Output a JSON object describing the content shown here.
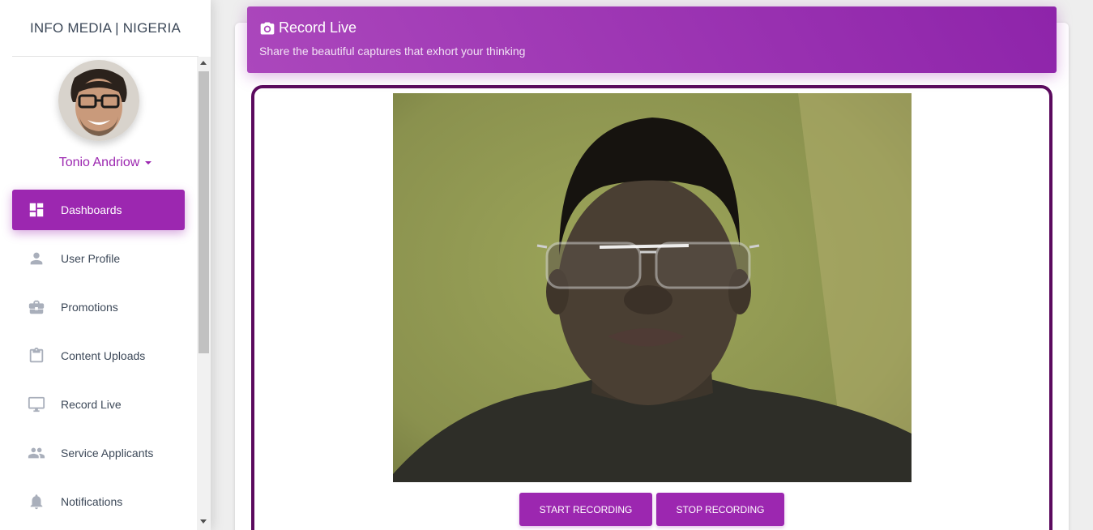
{
  "sidebar": {
    "brand": "INFO MEDIA | NIGERIA",
    "user_name": "Tonio Andriow",
    "items": [
      {
        "label": "Dashboards",
        "icon": "dashboard-icon",
        "active": true
      },
      {
        "label": "User Profile",
        "icon": "person-icon",
        "active": false
      },
      {
        "label": "Promotions",
        "icon": "briefcase-icon",
        "active": false
      },
      {
        "label": "Content Uploads",
        "icon": "clipboard-icon",
        "active": false
      },
      {
        "label": "Record Live",
        "icon": "monitor-icon",
        "active": false
      },
      {
        "label": "Service Applicants",
        "icon": "people-icon",
        "active": false
      },
      {
        "label": "Notifications",
        "icon": "bell-icon",
        "active": false
      }
    ]
  },
  "card": {
    "title": "Record Live",
    "subtitle": "Share the beautiful captures that exhort your thinking",
    "header_icon": "camera-icon"
  },
  "controls": {
    "start_label": "START RECORDING",
    "stop_label": "STOP RECORDING"
  },
  "colors": {
    "accent": "#9c27b0",
    "frame_border": "#5b0a5e",
    "text_dark": "#3c4858"
  }
}
